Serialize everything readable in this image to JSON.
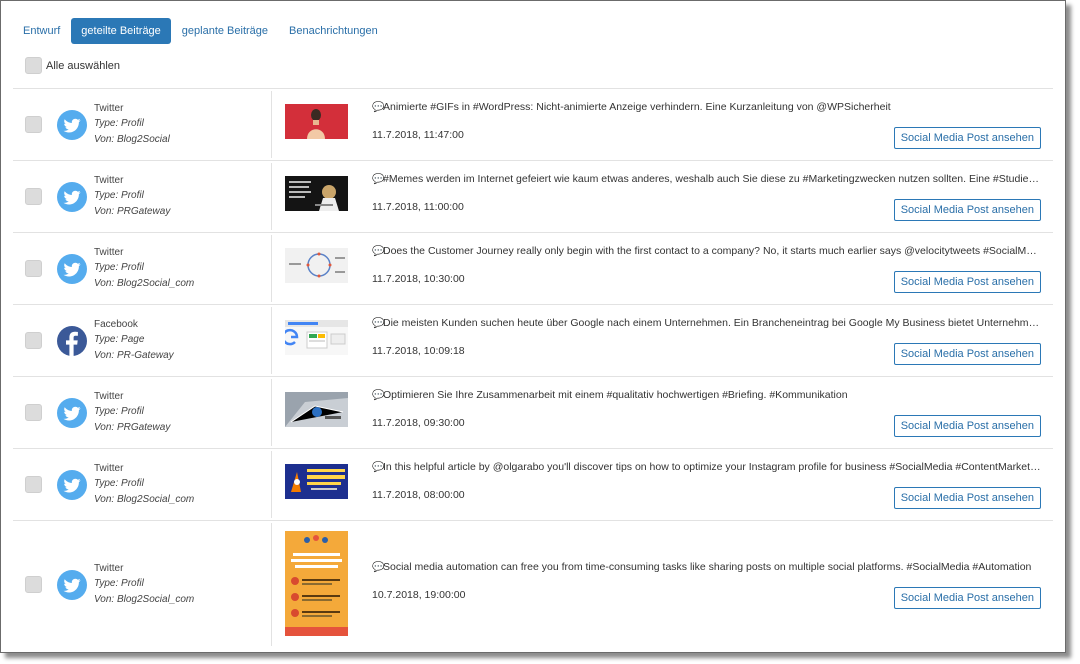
{
  "tabs": [
    {
      "label": "Entwurf",
      "active": false
    },
    {
      "label": "geteilte Beiträge",
      "active": true
    },
    {
      "label": "geplante Beiträge",
      "active": false
    },
    {
      "label": "Benachrichtungen",
      "active": false
    }
  ],
  "select_all_label": "Alle auswählen",
  "view_button_label": "Social Media Post ansehen",
  "colors": {
    "accent": "#2b78b6",
    "twitter": "#55acee",
    "facebook": "#3b5998"
  },
  "posts": [
    {
      "network": "Twitter",
      "icon": "twitter-icon",
      "type": "Type: Profil",
      "by": "Von: Blog2Social",
      "text": "Animierte #GIFs in #WordPress: Nicht-animierte Anzeige verhindern. Eine Kurzanleitung von @WPSicherheit",
      "date": "11.7.2018, 11:47:00"
    },
    {
      "network": "Twitter",
      "icon": "twitter-icon",
      "type": "Type: Profil",
      "by": "Von: PRGateway",
      "text": "#Memes werden im Internet gefeiert wie kaum etwas anderes, weshalb auch Sie diese zu #Marketingzwecken nutzen sollten. Eine #Studie zeigt warum",
      "date": "11.7.2018, 11:00:00"
    },
    {
      "network": "Twitter",
      "icon": "twitter-icon",
      "type": "Type: Profil",
      "by": "Von: Blog2Social_com",
      "text": "Does the Customer Journey really only begin with the first contact to a company? No, it starts much earlier says @velocitytweets #SocialMedia",
      "date": "11.7.2018, 10:30:00"
    },
    {
      "network": "Facebook",
      "icon": "facebook-icon",
      "type": "Type: Page",
      "by": "Von: PR-Gateway",
      "text": "Die meisten Kunden suchen heute über Google nach einem Unternehmen. Ein Brancheneintrag bei Google My Business bietet Unternehmen viele Vorteile",
      "date": "11.7.2018, 10:09:18"
    },
    {
      "network": "Twitter",
      "icon": "twitter-icon",
      "type": "Type: Profil",
      "by": "Von: PRGateway",
      "text": "Optimieren Sie Ihre Zusammenarbeit mit einem #qualitativ hochwertigen #Briefing. #Kommunikation",
      "date": "11.7.2018, 09:30:00"
    },
    {
      "network": "Twitter",
      "icon": "twitter-icon",
      "type": "Type: Profil",
      "by": "Von: Blog2Social_com",
      "text": "In this helpful article by @olgarabo you'll discover tips on how to optimize your Instagram profile for business #SocialMedia #ContentMarketing",
      "date": "11.7.2018, 08:00:00"
    },
    {
      "network": "Twitter",
      "icon": "twitter-icon",
      "type": "Type: Profil",
      "by": "Von: Blog2Social_com",
      "text": "Social media automation can free you from time-consuming tasks like sharing posts on multiple social platforms. #SocialMedia #Automation",
      "date": "10.7.2018, 19:00:00"
    }
  ]
}
